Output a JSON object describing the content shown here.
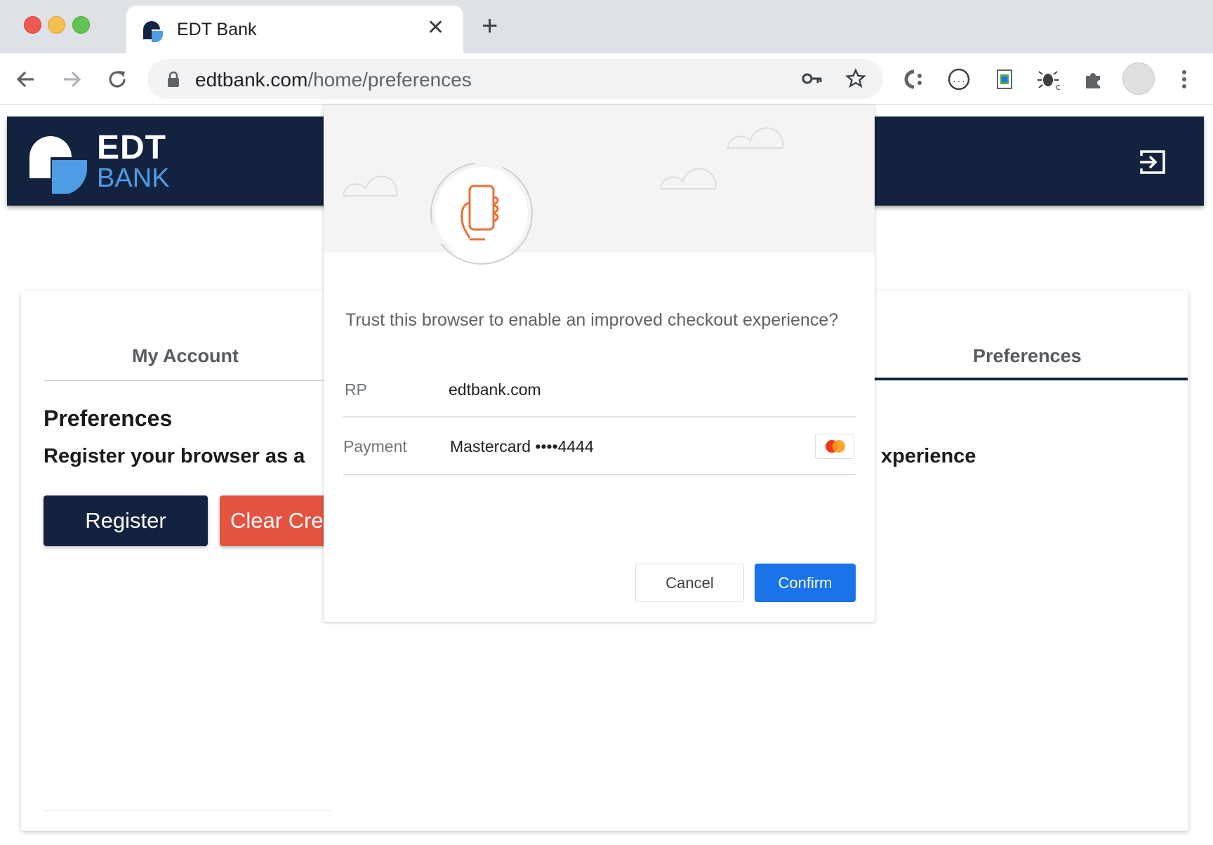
{
  "browser": {
    "tab_title": "EDT Bank",
    "url_domain": "edtbank.com",
    "url_path": "/home/preferences"
  },
  "site": {
    "logo_line1": "EDT",
    "logo_line2": "BANK",
    "brand_color": "#13233f",
    "accent_color": "#4f9be4"
  },
  "account_card": {
    "tabs": [
      {
        "label": "My Account"
      },
      {
        "label": "Preferences",
        "selected": true
      }
    ],
    "title": "Preferences",
    "description_visible_start": "Register your browser as a",
    "description_visible_end": "xperience",
    "register_label": "Register",
    "clear_label": "Clear Cre"
  },
  "dialog": {
    "question": "Trust this browser to enable an improved checkout experience?",
    "rows": [
      {
        "label": "RP",
        "value": "edtbank.com"
      },
      {
        "label": "Payment",
        "value": "Mastercard ••••4444",
        "icon": "mastercard-icon"
      }
    ],
    "cancel_label": "Cancel",
    "confirm_label": "Confirm",
    "confirm_color": "#1a73e8",
    "hero_icon": "phone-in-hand-icon"
  }
}
